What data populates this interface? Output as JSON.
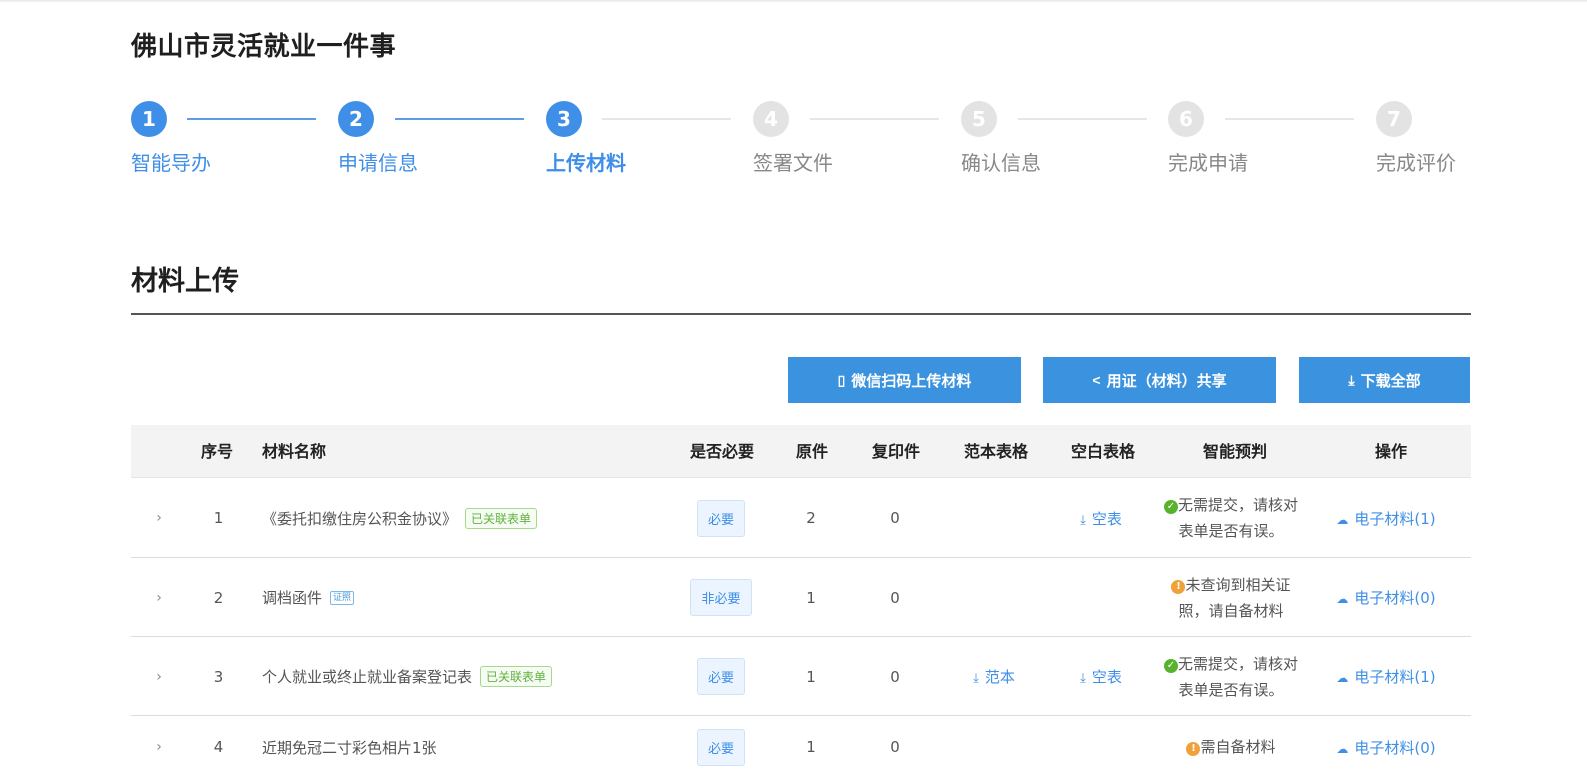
{
  "page": {
    "title": "佛山市灵活就业一件事"
  },
  "steps": [
    {
      "num": "1",
      "label": "智能导办",
      "state": "done"
    },
    {
      "num": "2",
      "label": "申请信息",
      "state": "done"
    },
    {
      "num": "3",
      "label": "上传材料",
      "state": "current"
    },
    {
      "num": "4",
      "label": "签署文件",
      "state": "todo"
    },
    {
      "num": "5",
      "label": "确认信息",
      "state": "todo"
    },
    {
      "num": "6",
      "label": "完成申请",
      "state": "todo"
    },
    {
      "num": "7",
      "label": "完成评价",
      "state": "todo"
    }
  ],
  "section": {
    "title": "材料上传"
  },
  "toolbar": {
    "wechat_label": "微信扫码上传材料",
    "share_label": "用证（材料）共享",
    "download_all_label": "下载全部"
  },
  "table": {
    "headers": {
      "index": "序号",
      "name": "材料名称",
      "required": "是否必要",
      "original": "原件",
      "copy": "复印件",
      "sample": "范本表格",
      "blank": "空白表格",
      "judge": "智能预判",
      "action": "操作"
    },
    "rows": [
      {
        "index": "1",
        "name": "《委托扣缴住房公积金协议》",
        "tag": "已关联表单",
        "required": "必要",
        "original": "2",
        "copy": "0",
        "sample": "",
        "blank": "空表",
        "judge_status": "ok",
        "judge_text": "无需提交，请核对表单是否有误。",
        "action": "电子材料(1)"
      },
      {
        "index": "2",
        "name": "调档函件",
        "tag": "",
        "card_tag": "证照",
        "required": "非必要",
        "original": "1",
        "copy": "0",
        "sample": "",
        "blank": "",
        "judge_status": "warn",
        "judge_text": "未查询到相关证照，请自备材料",
        "action": "电子材料(0)"
      },
      {
        "index": "3",
        "name": "个人就业或终止就业备案登记表",
        "tag": "已关联表单",
        "required": "必要",
        "original": "1",
        "copy": "0",
        "sample": "范本",
        "blank": "空表",
        "judge_status": "ok",
        "judge_text": "无需提交，请核对表单是否有误。",
        "action": "电子材料(1)"
      },
      {
        "index": "4",
        "name": "近期免冠二寸彩色相片1张",
        "tag": "",
        "required": "必要",
        "original": "1",
        "copy": "0",
        "sample": "",
        "blank": "",
        "judge_status": "warn",
        "judge_text": "需自备材料",
        "action": "电子材料(0)"
      }
    ]
  }
}
